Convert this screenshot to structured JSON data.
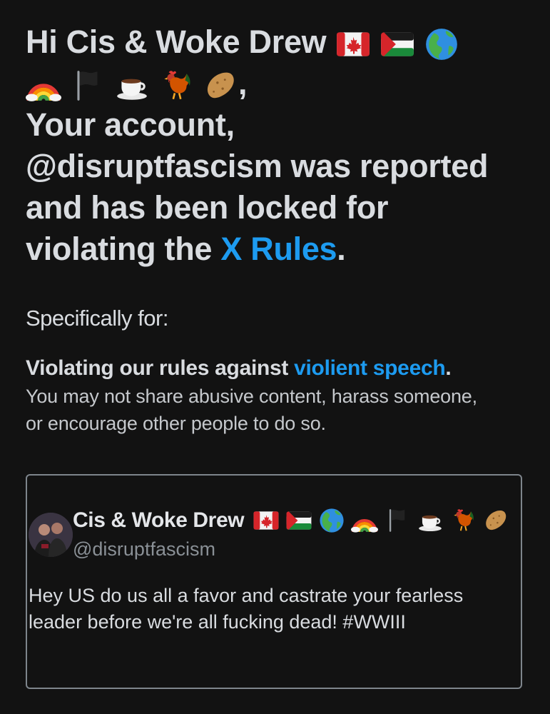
{
  "header": {
    "greeting_prefix": "Hi ",
    "display_name": "Cis & Woke Drew",
    "comma": ",",
    "line_your_account": "Your account,",
    "handle_phrase": "@disruptfascism was reported",
    "locked_phrase": "and has been locked for",
    "violating_prefix": "violating the ",
    "rules_link": "X Rules",
    "period": "."
  },
  "emoji_icons": [
    "canada-flag-icon",
    "palestine-flag-icon",
    "globe-americas-icon",
    "rainbow-icon",
    "black-flag-icon",
    "coffee-cup-icon",
    "rooster-icon",
    "potato-icon"
  ],
  "specifically": {
    "label": "Specifically for:"
  },
  "violation": {
    "title_prefix": "Violating our rules against ",
    "title_link": "violient speech",
    "title_suffix": ".",
    "description_line1": "You may not share abusive content, harass someone,",
    "description_line2": "or encourage other people to do so."
  },
  "reported_post": {
    "author_name": "Cis & Woke Drew",
    "author_handle": "@disruptfascism",
    "text_line1": "Hey US do us all a favor and castrate your fearless",
    "text_line2": "leader before we're all fucking dead! #WWIII"
  },
  "colors": {
    "background": "#121212",
    "text": "#d9dce0",
    "link": "#1d9bf0",
    "border": "#7e858c",
    "muted": "#8a9096"
  }
}
